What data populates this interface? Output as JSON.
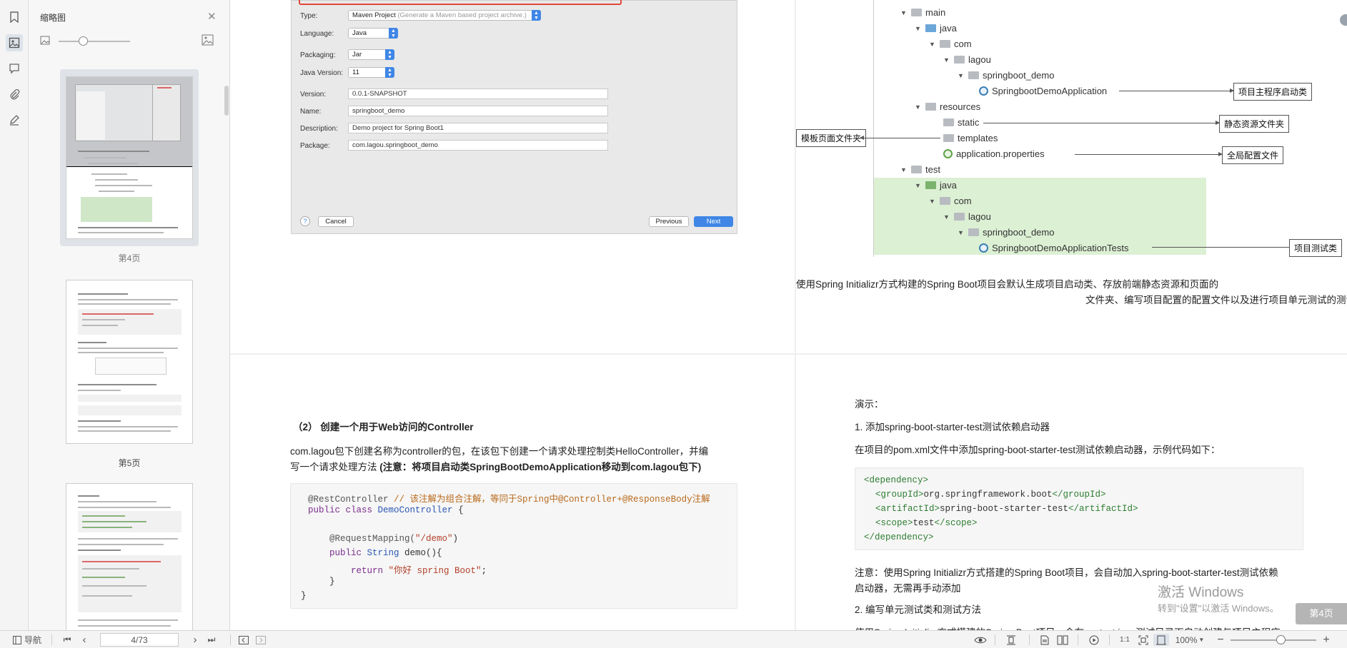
{
  "left_toolbar": {
    "icons": [
      "bookmark-icon",
      "thumbnail-icon",
      "comment-icon",
      "attachment-icon",
      "signature-icon"
    ]
  },
  "thumb_panel": {
    "title": "缩略图",
    "pages": [
      {
        "label": "第4页",
        "selected": true
      },
      {
        "label": "第5页",
        "selected": false
      },
      {
        "label": "",
        "selected": false
      }
    ]
  },
  "wizard": {
    "fields": [
      {
        "label": "Type:",
        "value": "Maven Project",
        "hint": "(Generate a Maven based project archive.)"
      },
      {
        "label": "Language:",
        "value": "Java"
      },
      {
        "label": "Packaging:",
        "value": "Jar"
      },
      {
        "label": "Java Version:",
        "value": "11"
      },
      {
        "label": "Version:",
        "value": "0.0.1-SNAPSHOT"
      },
      {
        "label": "Name:",
        "value": "springboot_demo"
      },
      {
        "label": "Description:",
        "value": "Demo project for Spring Boot1"
      },
      {
        "label": "Package:",
        "value": "com.lagou.springboot_demo"
      }
    ],
    "help": "?",
    "cancel": "Cancel",
    "previous": "Previous",
    "next": "Next"
  },
  "tree": {
    "items": [
      "main",
      "java",
      "com",
      "lagou",
      "springboot_demo",
      "SpringbootDemoApplication",
      "resources",
      "static",
      "templates",
      "application.properties",
      "test",
      "java",
      "com",
      "lagou",
      "springboot_demo",
      "SpringbootDemoApplicationTests"
    ],
    "annotations": {
      "main_class": "项目主程序启动类",
      "static": "静态资源文件夹",
      "templates": "模板页面文件夹",
      "config": "全局配置文件",
      "tests": "项目测试类"
    },
    "caption_line1": "使用Spring Initializr方式构建的Spring Boot项目会默认生成项目启动类、存放前端静态资源和页面的",
    "caption_line2": "文件夹、编写项目配置的配置文件以及进行项目单元测试的测试类"
  },
  "controller_section": {
    "heading": "（2） 创建一个用于Web访问的Controller",
    "para_line1": "com.lagou包下创建名称为controller的包，在该包下创建一个请求处理控制类HelloController，并编",
    "para_line2_a": "写一个请求处理方法 ",
    "para_line2_b": "(注意：将项目启动类SpringBootDemoApplication移动到com.lagou包下)",
    "code": {
      "l1a": "@RestController",
      "l1b": " // 该注解为组合注解，等同于Spring中@Controller+@ResponseBody注解",
      "l2a": "public class ",
      "l2b": "DemoController",
      "l2c": " {",
      "l3a": "    @RequestMapping(",
      "l3b": "\"/demo\"",
      "l3c": ")",
      "l4a": "    public ",
      "l4b": "String",
      "l4c": " demo(){",
      "l5a": "        return ",
      "l5b": "\"你好 spring Boot\"",
      "l5c": ";",
      "l6": "    }",
      "l7": "}"
    }
  },
  "test_section": {
    "demo_label": "演示：",
    "step1": "1.  添加spring-boot-starter-test测试依赖启动器",
    "step1_desc": "在项目的pom.xml文件中添加spring-boot-starter-test测试依赖启动器，示例代码如下：",
    "xml": {
      "l1": "<dependency>",
      "l2a": "<groupId>",
      "l2b": "org.springframework.boot",
      "l2c": "</groupId>",
      "l3a": "<artifactId>",
      "l3b": "spring-boot-starter-test",
      "l3c": "</artifactId>",
      "l4a": "<scope>",
      "l4b": "test",
      "l4c": "</scope>",
      "l5": "</dependency>"
    },
    "note_line1": "注意：使用Spring Initializr方式搭建的Spring Boot项目，会自动加入spring-boot-starter-test测试依赖",
    "note_line2": "启动器，无需再手动添加",
    "step2": "2.  编写单元测试类和测试方法",
    "cut_line": "使用Spring Initializr方式搭建的Spring Boot项目，会在src.test.java测试目录下自动创建与项目主程序"
  },
  "watermark": {
    "line1": "激活 Windows",
    "line2": "转到\"设置\"以激活 Windows。"
  },
  "page_badge": "第4页",
  "statusbar": {
    "nav_label": "导航",
    "page_input": "4/73",
    "zoom": "100%",
    "zoom_level": 0.58
  }
}
